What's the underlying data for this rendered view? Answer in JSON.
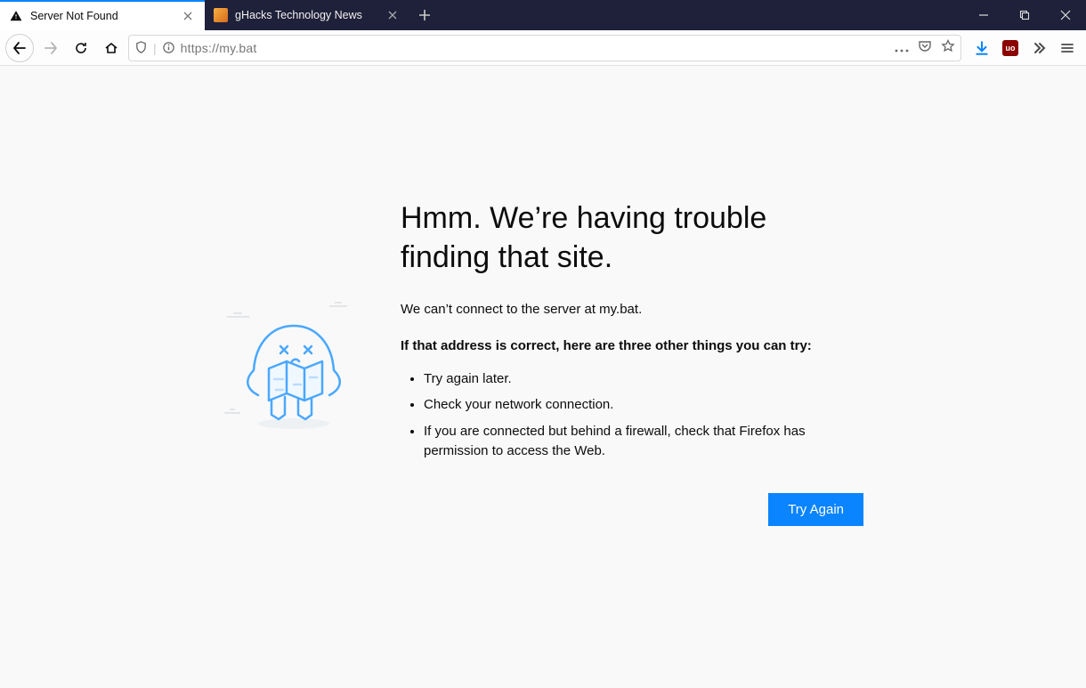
{
  "tabs": [
    {
      "title": "Server Not Found"
    },
    {
      "title": "gHacks Technology News"
    }
  ],
  "url": "https://my.bat",
  "error": {
    "heading": "Hmm. We’re having trouble finding that site.",
    "message": "We can’t connect to the server at my.bat.",
    "hint_title": "If that address is correct, here are three other things you can try:",
    "suggestions": [
      "Try again later.",
      "Check your network connection.",
      "If you are connected but behind a firewall, check that Firefox has permission to access the Web."
    ],
    "button": "Try Again"
  },
  "ublock_label": "uo"
}
